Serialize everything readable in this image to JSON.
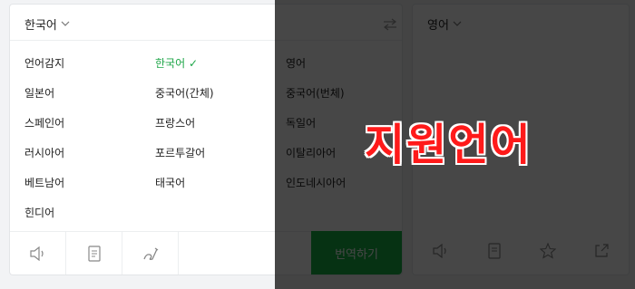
{
  "source": {
    "language_label": "한국어",
    "languages": [
      {
        "label": "언어감지"
      },
      {
        "label": "한국어",
        "selected": true
      },
      {
        "label": "영어"
      },
      {
        "label": "일본어"
      },
      {
        "label": "중국어(간체)"
      },
      {
        "label": "중국어(번체)"
      },
      {
        "label": "스페인어"
      },
      {
        "label": "프랑스어"
      },
      {
        "label": "독일어"
      },
      {
        "label": "러시아어"
      },
      {
        "label": "포르투갈어"
      },
      {
        "label": "이탈리아어"
      },
      {
        "label": "베트남어"
      },
      {
        "label": "태국어"
      },
      {
        "label": "인도네시아어"
      },
      {
        "label": "힌디어"
      }
    ],
    "translate_button": "번역하기"
  },
  "target": {
    "language_label": "영어"
  },
  "overlay": {
    "title": "지원언어"
  },
  "icons": {
    "speaker": "speaker-icon",
    "document": "document-icon",
    "handwriting": "handwriting-icon",
    "swap": "swap-icon",
    "star": "star-icon",
    "share": "share-icon"
  },
  "colors": {
    "accent": "#1ea648",
    "button": "#18b346",
    "overlay_title": "#ff1a1a"
  }
}
